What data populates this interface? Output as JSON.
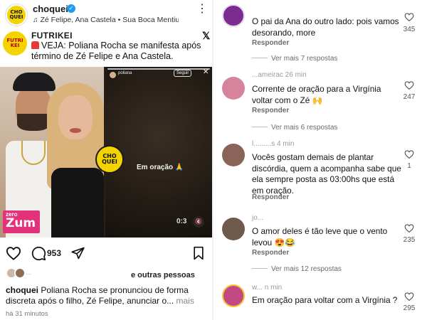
{
  "post": {
    "username": "choquei",
    "music": "Zé Felipe, Ana Castela • Sua Boca Mentiu",
    "avatar_text": "CHO QUEI"
  },
  "news_card": {
    "source": "FUTRIKEI",
    "logo_text": "FUTRI KEI",
    "headline": "VEJA: Poliana Rocha se manifesta após término de Zé Felipe e Ana Castela."
  },
  "photo": {
    "badge_text": "CHO QUEI",
    "zero_badge_top": "zero",
    "zero_badge_main": "Zum",
    "story_user": "poliana",
    "story_follow": "Seguir",
    "story_text": "Em oração 🙏",
    "story_timer": "0:3"
  },
  "actions": {
    "comment_count": "953"
  },
  "liked_by": {
    "faded_text": "...",
    "text": "e outras pessoas"
  },
  "caption": {
    "username": "choquei",
    "text": "Poliana Rocha se pronunciou de forma discreta após o filho, Zé Felipe, anunciar o...",
    "more": "mais",
    "time": "há 31 minutos"
  },
  "comments": [
    {
      "user": "",
      "text": "O pai da Ana do outro lado: pois vamos desorando, more",
      "reply": "Responder",
      "likes": "345",
      "avatar_color": "#7b2d8e",
      "view_more": "Ver mais 7 respostas"
    },
    {
      "user": "...ameirac  26 min",
      "text": "Corrente de oração para a Virgínia voltar com o Zé 🙌",
      "reply": "Responder",
      "likes": "247",
      "avatar_color": "#d7839b",
      "view_more": "Ver mais 6 respostas"
    },
    {
      "user": "l.........s  4 min",
      "text": "Vocês gostam demais de plantar discórdia, quem a acompanha sabe que ela sempre posta as 03:00hs que está em oração.",
      "reply": "Responder",
      "likes": "1",
      "avatar_color": "#8a6458",
      "view_more": ""
    },
    {
      "user": "jo...",
      "text": "O amor deles é tão leve que o vento levou 😍😂",
      "reply": "Responder",
      "likes": "235",
      "avatar_color": "#6f5a4c",
      "view_more": "Ver mais 12 respostas"
    },
    {
      "user": "w...  n min",
      "text": "Em oração para voltar com a Virgínia ?",
      "reply": "",
      "likes": "295",
      "avatar_color": "#c24a84",
      "view_more": ""
    }
  ],
  "colors": {
    "verified": "#1d9bf0",
    "choquei_yellow": "#f3d400",
    "zero_pink": "#e4327a"
  },
  "icons": [
    "music-note-icon",
    "more-vert-icon",
    "x-logo-icon",
    "siren-icon",
    "heart-icon",
    "comment-icon",
    "share-icon",
    "save-icon",
    "mute-icon",
    "close-icon"
  ]
}
